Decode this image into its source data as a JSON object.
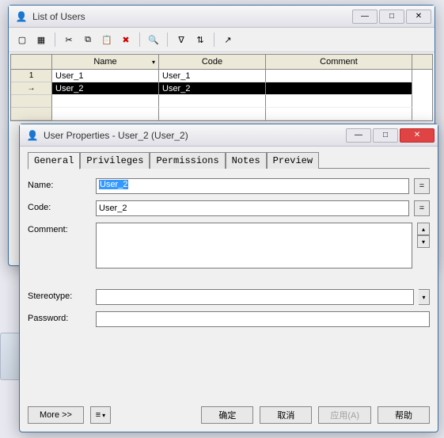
{
  "list_window": {
    "title": "List of Users",
    "columns": {
      "name": "Name",
      "code": "Code",
      "comment": "Comment"
    },
    "rows": [
      {
        "idx": "1",
        "name": "User_1",
        "code": "User_1",
        "comment": ""
      },
      {
        "idx": "→",
        "name": "User_2",
        "code": "User_2",
        "comment": ""
      }
    ]
  },
  "dialog": {
    "title": "User Properties - User_2 (User_2)",
    "tabs": [
      "General",
      "Privileges",
      "Permissions",
      "Notes",
      "Preview"
    ],
    "active_tab": 0,
    "fields": {
      "name_label": "Name:",
      "name_value": "User_2",
      "code_label": "Code:",
      "code_value": "User_2",
      "comment_label": "Comment:",
      "comment_value": "",
      "stereotype_label": "Stereotype:",
      "stereotype_value": "",
      "password_label": "Password:",
      "password_value": ""
    },
    "buttons": {
      "more": "More >>",
      "ok": "确定",
      "cancel": "取消",
      "apply": "应用(A)",
      "help": "帮助"
    },
    "eq": "="
  },
  "glyph": {
    "min": "—",
    "max": "□",
    "close": "✕",
    "down": "▾",
    "up": "▴",
    "right": "▸",
    "arrow": "➔",
    "new": "▢",
    "grid": "▦",
    "cut": "✂",
    "copy": "⧉",
    "paste": "📋",
    "del": "✖",
    "find": "🔍",
    "filter": "∇",
    "sort": "⇅",
    "export": "↗",
    "user": "👤",
    "menu": "≡"
  }
}
